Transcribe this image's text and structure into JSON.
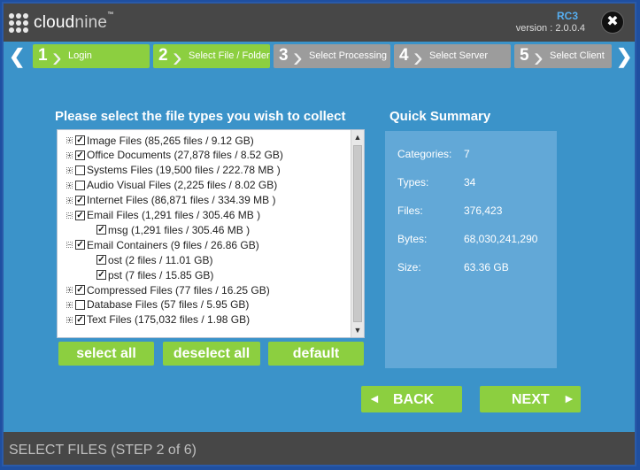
{
  "app": {
    "logo_text_cloud": "cloud",
    "logo_text_nine": "nine",
    "logo_tm": "™",
    "release": "RC3",
    "version": "version : 2.0.0.4",
    "close_glyph": "✖"
  },
  "steps": [
    {
      "num": "1",
      "label": "Login",
      "active": true
    },
    {
      "num": "2",
      "label": "Select File / Folder",
      "active": true
    },
    {
      "num": "3",
      "label": "Select Processing",
      "active": false
    },
    {
      "num": "4",
      "label": "Select Server",
      "active": false
    },
    {
      "num": "5",
      "label": "Select Client",
      "active": false
    }
  ],
  "nav_arrows": {
    "prev": "❮",
    "next": "❯"
  },
  "file_types": {
    "title": "Please select the file types you wish to collect",
    "items": [
      {
        "expander": "+",
        "checked": true,
        "label": "Image Files (85,265 files / 9.12 GB)"
      },
      {
        "expander": "+",
        "checked": true,
        "label": "Office Documents (27,878 files / 8.52 GB)"
      },
      {
        "expander": "+",
        "checked": false,
        "label": "Systems Files (19,500 files / 222.78 MB  )"
      },
      {
        "expander": "+",
        "checked": false,
        "label": "Audio Visual Files (2,225 files / 8.02 GB)"
      },
      {
        "expander": "+",
        "checked": true,
        "label": "Internet Files (86,871 files / 334.39 MB  )"
      },
      {
        "expander": "−",
        "checked": true,
        "label": "Email Files (1,291 files / 305.46 MB  )"
      },
      {
        "expander": "",
        "checked": true,
        "label": "msg (1,291 files / 305.46 MB  )",
        "child": true
      },
      {
        "expander": "−",
        "checked": true,
        "label": "Email Containers (9 files / 26.86 GB)"
      },
      {
        "expander": "",
        "checked": true,
        "label": "ost (2 files / 11.01 GB)",
        "child": true
      },
      {
        "expander": "",
        "checked": true,
        "label": "pst (7 files / 15.85 GB)",
        "child": true
      },
      {
        "expander": "+",
        "checked": true,
        "label": "Compressed Files (77 files / 16.25 GB)"
      },
      {
        "expander": "+",
        "checked": false,
        "label": "Database Files (57 files / 5.95 GB)"
      },
      {
        "expander": "+",
        "checked": true,
        "label": "Text Files (175,032 files / 1.98 GB)"
      }
    ],
    "check_glyph": "✓",
    "scroll_up": "▲",
    "scroll_down": "▼"
  },
  "buttons": {
    "select_all": "select all",
    "deselect_all": "deselect all",
    "default": "default",
    "back": "BACK",
    "next": "NEXT",
    "back_glyph": "◄",
    "next_glyph": "►"
  },
  "summary": {
    "title": "Quick Summary",
    "rows": [
      {
        "label": "Categories:",
        "value": "7"
      },
      {
        "label": "Types:",
        "value": "34"
      },
      {
        "label": "Files:",
        "value": "376,423"
      },
      {
        "label": "Bytes:",
        "value": "68,030,241,290"
      },
      {
        "label": "Size:",
        "value": "63.36 GB"
      }
    ]
  },
  "status": {
    "text": "SELECT FILES (STEP 2 of 6)"
  },
  "colors": {
    "accent_green": "#8ccf40",
    "inactive_step": "#9c9c9c",
    "background": "#3b93c9",
    "bar": "#474747"
  }
}
